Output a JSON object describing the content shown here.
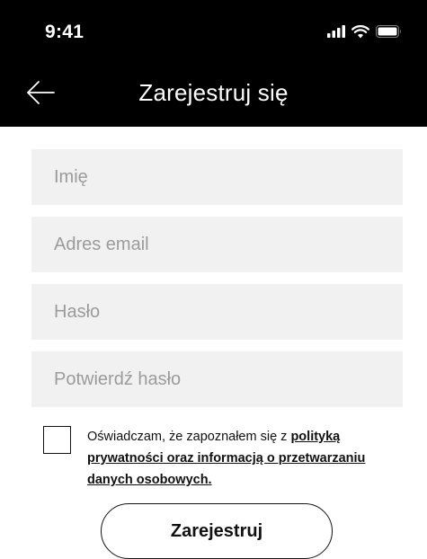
{
  "status_bar": {
    "time": "9:41"
  },
  "header": {
    "title": "Zarejestruj się",
    "back_icon": "arrow-left-icon"
  },
  "form": {
    "name_placeholder": "Imię",
    "email_placeholder": "Adres email",
    "password_placeholder": "Hasło",
    "confirm_password_placeholder": "Potwierdź hasło",
    "consent": {
      "checked": false,
      "prefix": "Oświadczam, że zapoznałem się z ",
      "link_text": "polityką prywatności oraz informacją o przetwarzaniu danych osobowych."
    },
    "submit_label": "Zarejestruj"
  },
  "colors": {
    "header_bg": "#000000",
    "field_bg": "#f1f1f1",
    "placeholder": "#9b9b9b"
  }
}
